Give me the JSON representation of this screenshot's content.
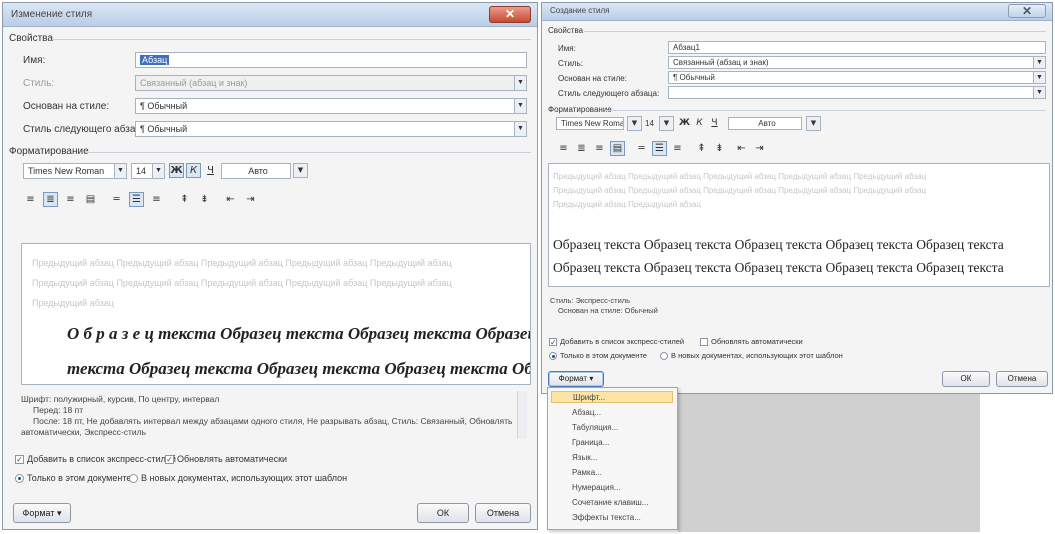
{
  "left_dialog": {
    "title": "Изменение стиля",
    "close": "✕",
    "properties_group": "Свойства",
    "name_label": "Имя:",
    "name_value": "Абзац",
    "style_type_label": "Стиль:",
    "style_type_value": "Связанный (абзац и знак)",
    "based_on_label": "Основан на стиле:",
    "based_on_value": "¶ Обычный",
    "next_style_label": "Стиль следующего абзаца:",
    "next_style_value": "¶ Обычный",
    "formatting_group": "Форматирование",
    "font_value": "Times New Roman",
    "size_value": "14",
    "bold": "Ж",
    "italic": "К",
    "underline": "Ч",
    "color_value": "Авто",
    "ghost_text": "Предыдущий абзац Предыдущий абзац Предыдущий абзац Предыдущий абзац Предыдущий абзац",
    "ghost_last": "Предыдущий абзац",
    "sample_line_1": "О б р а з е ц текста Образец текста Образец текста Образец",
    "sample_line_2": "текста Образец текста Образец текста Образец текста Образец",
    "description_1": "Шрифт: полужирный, курсив, По центру, интервал",
    "description_2": "Перед: 18 пт",
    "description_3": "После: 18 пт, Не добавлять интервал между абзацами одного стиля, Не разрывать абзац, Стиль: Связанный, Обновлять",
    "description_4": "автоматически, Экспресс-стиль",
    "add_to_quick": "Добавить в список экспресс-стилей",
    "auto_update": "Обновлять автоматически",
    "only_this_doc": "Только в этом документе",
    "new_docs": "В новых документах, использующих этот шаблон",
    "format_button": "Формат ▾",
    "ok_button": "ОК",
    "cancel_button": "Отмена"
  },
  "right_dialog": {
    "title": "Создание стиля",
    "close": "✕",
    "properties_group": "Свойства",
    "name_label": "Имя:",
    "name_value": "Абзац1",
    "style_type_label": "Стиль:",
    "style_type_value": "Связанный (абзац и знак)",
    "based_on_label": "Основан на стиле:",
    "based_on_value": "¶ Обычный",
    "next_style_label": "Стиль следующего абзаца:",
    "next_style_value": "",
    "formatting_group": "Форматирование",
    "font_value": "Times New Roman",
    "size_value": "14",
    "bold": "Ж",
    "italic": "К",
    "underline": "Ч",
    "color_value": "Авто",
    "ghost_text": "Предыдущий абзац Предыдущий абзац Предыдущий абзац Предыдущий абзац Предыдущий абзац",
    "ghost_text_2": "Предыдущий абзац Предыдущий абзац",
    "sample_line_1": "Образец текста Образец текста Образец текста Образец текста Образец текста",
    "sample_line_2": "Образец текста Образец текста Образец текста Образец текста Образец текста",
    "description_1": "Стиль: Экспресс-стиль",
    "description_2": "Основан на стиле: Обычный",
    "add_to_quick": "Добавить в список экспресс-стилей",
    "auto_update": "Обновлять автоматически",
    "only_this_doc": "Только в этом документе",
    "new_docs": "В новых документах, использующих этот шаблон",
    "format_button": "Формат ▾",
    "ok_button": "ОК",
    "cancel_button": "Отмена"
  },
  "format_menu": {
    "items": [
      "Шрифт...",
      "Абзац...",
      "Табуляция...",
      "Граница...",
      "Язык...",
      "Рамка...",
      "Нумерация...",
      "Сочетание клавиш...",
      "Эффекты текста..."
    ]
  },
  "toolbar_glyphs": {
    "align_left": "≡",
    "align_center": "≣",
    "align_right": "≡",
    "justify": "▤",
    "spacing_1": "═",
    "spacing_2": "☰",
    "spacing_3": "≡",
    "space_before": "⇞",
    "space_after": "⇟",
    "indent_dec": "⇤",
    "indent_inc": "⇥"
  }
}
